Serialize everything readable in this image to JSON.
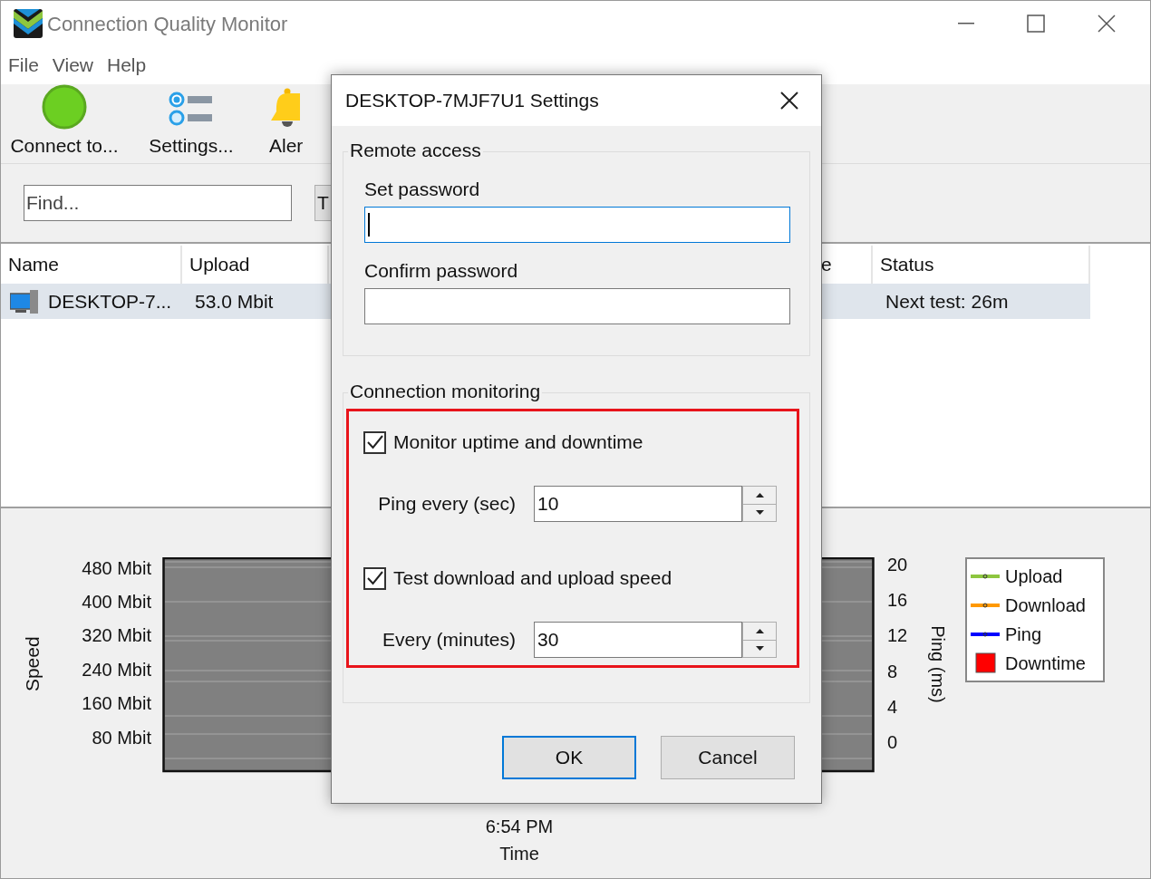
{
  "window": {
    "title": "Connection Quality Monitor"
  },
  "menu": [
    "File",
    "View",
    "Help"
  ],
  "toolbar": [
    {
      "kind": "connect",
      "label": "Connect to..."
    },
    {
      "kind": "settings",
      "label": "Settings..."
    },
    {
      "kind": "alert",
      "label": "Aler"
    }
  ],
  "search": {
    "placeholder": "Find...",
    "button": "T"
  },
  "table": {
    "columns": [
      "Name",
      "Upload",
      "e",
      "Status"
    ],
    "rows": [
      {
        "name": "DESKTOP-7...",
        "upload": "53.0 Mbit",
        "status": "Next test: 26m",
        "selected": true
      }
    ]
  },
  "chart": {
    "ylabel": "Speed",
    "yticks": [
      "480 Mbit",
      "400 Mbit",
      "320 Mbit",
      "240 Mbit",
      "160 Mbit",
      "80 Mbit"
    ],
    "y2label": "Ping (ms)",
    "y2ticks": [
      "20",
      "16",
      "12",
      "8",
      "4",
      "0"
    ],
    "xtick": "6:54 PM",
    "xlabel": "Time",
    "legend": [
      {
        "label": "Upload",
        "kind": "line",
        "color": "#8dc63f"
      },
      {
        "label": "Download",
        "kind": "line",
        "color": "#ff9900"
      },
      {
        "label": "Ping",
        "kind": "line",
        "color": "#0000ff"
      },
      {
        "label": "Downtime",
        "kind": "box",
        "color": "#ff0000"
      }
    ]
  },
  "dialog": {
    "title": "DESKTOP-7MJF7U1 Settings",
    "remote": {
      "title": "Remote access",
      "fields": [
        {
          "label": "Set password",
          "focused": true
        },
        {
          "label": "Confirm password",
          "focused": false
        }
      ]
    },
    "monitoring": {
      "title": "Connection monitoring",
      "highlighted": true,
      "items": [
        {
          "kind": "checkbox",
          "label": "Monitor uptime and downtime",
          "checked": true
        },
        {
          "kind": "spinner",
          "label": "Ping every (sec)",
          "value": "10"
        },
        {
          "kind": "checkbox",
          "label": "Test download and upload speed",
          "checked": true
        },
        {
          "kind": "spinner",
          "label": "Every (minutes)",
          "value": "30"
        }
      ]
    },
    "buttons": [
      {
        "label": "OK",
        "default": true
      },
      {
        "label": "Cancel",
        "default": false
      }
    ]
  }
}
